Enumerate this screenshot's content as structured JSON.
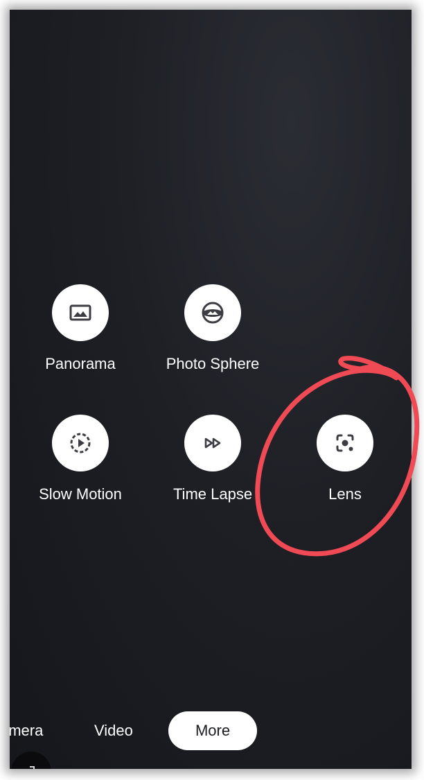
{
  "modes": [
    {
      "id": "panorama",
      "label": "Panorama",
      "icon": "panorama-icon"
    },
    {
      "id": "photo-sphere",
      "label": "Photo Sphere",
      "icon": "photo-sphere-icon"
    },
    {
      "id": "slow-motion",
      "label": "Slow Motion",
      "icon": "slow-motion-icon"
    },
    {
      "id": "time-lapse",
      "label": "Time Lapse",
      "icon": "time-lapse-icon"
    },
    {
      "id": "lens",
      "label": "Lens",
      "icon": "lens-icon"
    }
  ],
  "bottom_tabs": {
    "camera": "amera",
    "video": "Video",
    "more": "More"
  },
  "colors": {
    "background": "#1d1f25",
    "circle": "#ffffff",
    "icon": "#3c3d42",
    "annotation": "#f04a55"
  }
}
